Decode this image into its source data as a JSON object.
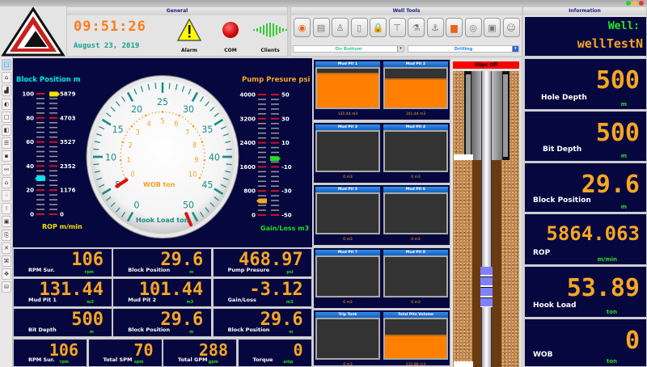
{
  "general": {
    "title": "General",
    "time": "09:51:26",
    "date": "August 23, 2019",
    "alarm_label": "Alarm",
    "com_label": "COM",
    "clients_label": "Clients"
  },
  "well_tools": {
    "title": "Well Tools",
    "icons": [
      "sensor-icon",
      "report-icon",
      "rig-icon",
      "device-icon",
      "lock-icon",
      "drill-bit-icon",
      "microscope-icon",
      "hook-icon",
      "tank-icon",
      "pump-icon",
      "panel-icon",
      "operator-icon"
    ],
    "bit_status": "On Bottom",
    "activity": "Drilling"
  },
  "information": {
    "title": "Information",
    "well_label": "Well:",
    "well_name": "wellTestN"
  },
  "sidebar": {
    "icons": [
      "select-icon",
      "home-icon",
      "chart-icon",
      "pie-icon",
      "window-icon",
      "split-icon",
      "rows-icon",
      "zoom-icon",
      "link-icon",
      "house-icon",
      "layers-icon",
      "grid-icon",
      "frame-icon",
      "export-icon",
      "tools-icon",
      "network-icon",
      "move-icon",
      "database-icon"
    ]
  },
  "gauges": {
    "block_position": {
      "title": "Block Position m",
      "ticks": [
        0,
        20,
        40,
        60,
        80,
        100
      ],
      "value": 29.6
    },
    "rop": {
      "title": "ROP m/min",
      "ticks": [
        0,
        1176,
        2352,
        3527,
        4703,
        5879
      ],
      "value": 5864.063
    },
    "pump_pressure": {
      "title": "Pump Presure psi",
      "ticks": [
        0,
        800,
        1600,
        2400,
        3200,
        4000
      ],
      "value": 468.97
    },
    "gain_loss": {
      "title": "Gain/Loss m3",
      "ticks": [
        -50,
        -30,
        -10,
        10,
        30,
        50
      ],
      "value": -3.12
    },
    "hook_load": {
      "title": "Hook Load ton",
      "min": 0,
      "max": 50,
      "value": 53.89
    },
    "wob": {
      "title": "WOB ton",
      "min": 0,
      "max": 10,
      "value": 0
    },
    "colors": {
      "hook_scale": "#1a8a8a",
      "wob_scale": "#f5a020",
      "needle": "#e01010",
      "block_marker": "#00e8e8",
      "rop_marker": "#f0e000",
      "gain_marker": "#20e020",
      "pump_marker": "#f5a623"
    }
  },
  "readouts": [
    [
      {
        "label": "RPM Sur.",
        "value": "106",
        "unit": "rpm"
      },
      {
        "label": "Block Position",
        "value": "29.6",
        "unit": "m"
      },
      {
        "label": "Pump Presure",
        "value": "468.97",
        "unit": "psi"
      }
    ],
    [
      {
        "label": "Mud Pit 1",
        "value": "131.44",
        "unit": "m3"
      },
      {
        "label": "Mud Pit 2",
        "value": "101.44",
        "unit": "m3"
      },
      {
        "label": "Gain/Loss",
        "value": "-3.12",
        "unit": "m3"
      }
    ],
    [
      {
        "label": "Bit Depth",
        "value": "500",
        "unit": "m"
      },
      {
        "label": "Block Position",
        "value": "29.6",
        "unit": "m"
      },
      {
        "label": "Block Position",
        "value": "29.6",
        "unit": "m"
      }
    ]
  ],
  "bottom_readouts": [
    {
      "label": "RPM Sur.",
      "value": "106",
      "unit": "rpm"
    },
    {
      "label": "Total SPM",
      "value": "70",
      "unit": "spm"
    },
    {
      "label": "Total GPM",
      "value": "288",
      "unit": "gpm"
    },
    {
      "label": "Torque",
      "value": "0",
      "unit": "amp"
    }
  ],
  "mud_pits": [
    {
      "name": "Mud Pit 1",
      "level": 0.9,
      "volume": "131.44 m3"
    },
    {
      "name": "Mud Pit 2",
      "level": 0.75,
      "volume": "101.44 m3"
    },
    {
      "name": "Mud Pit 3",
      "level": 0,
      "volume": "0 m3"
    },
    {
      "name": "Mud Pit 4",
      "level": 0,
      "volume": "0 m3"
    },
    {
      "name": "Mud Pit 5",
      "level": 0,
      "volume": "0 m3"
    },
    {
      "name": "Mud Pit 6",
      "level": 0,
      "volume": "0 m3"
    },
    {
      "name": "Mud Pit 7",
      "level": 0,
      "volume": "0 m3"
    },
    {
      "name": "Mud Pit 8",
      "level": 0,
      "volume": "0 m3"
    },
    {
      "name": "Trip Tank",
      "level": 0,
      "volume": "0 m3"
    },
    {
      "name": "Total Pits Volume",
      "level": 0.6,
      "volume": "232.88 m3"
    }
  ],
  "wellbore": {
    "slips_status": "Slips Off"
  },
  "info_cells": [
    {
      "label": "Hole Depth",
      "value": "500",
      "unit": "m"
    },
    {
      "label": "Bit Depth",
      "value": "500",
      "unit": "m"
    },
    {
      "label": "Block Position",
      "value": "29.6",
      "unit": "m"
    },
    {
      "label": "ROP",
      "value": "5864.063",
      "unit": "m/min"
    },
    {
      "label": "Hook Load",
      "value": "53.89",
      "unit": "ton"
    },
    {
      "label": "WOB",
      "value": "0",
      "unit": "ton"
    }
  ]
}
